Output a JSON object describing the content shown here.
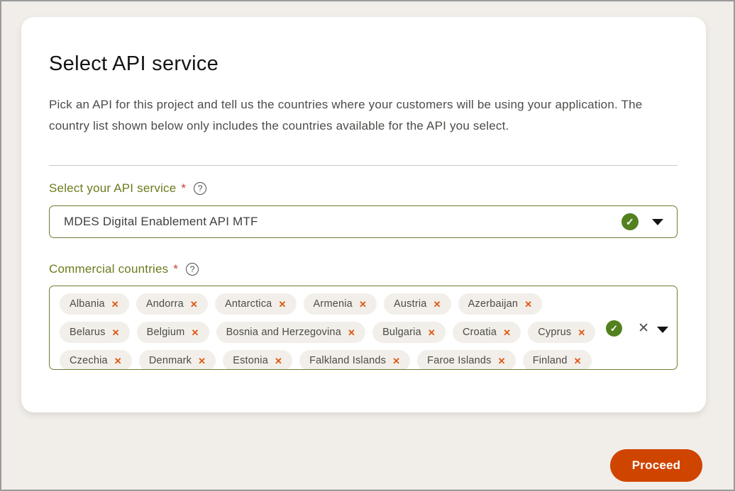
{
  "page": {
    "title": "Select API service",
    "description": "Pick an API for this project and tell us the countries where your customers will be using your application. The country list shown below only includes the countries available for the API you select."
  },
  "icons": {
    "help_glyph": "?",
    "check_glyph": "✓",
    "chip_remove_glyph": "✕",
    "clear_glyph": "✕"
  },
  "api_service_field": {
    "label": "Select your API service",
    "required_marker": "*",
    "selected_value": "MDES Digital Enablement API MTF"
  },
  "countries_field": {
    "label": "Commercial countries",
    "required_marker": "*",
    "selected_countries": [
      "Albania",
      "Andorra",
      "Antarctica",
      "Armenia",
      "Austria",
      "Azerbaijan",
      "Belarus",
      "Belgium",
      "Bosnia and Herzegovina",
      "Bulgaria",
      "Croatia",
      "Cyprus",
      "Czechia",
      "Denmark",
      "Estonia",
      "Falkland Islands",
      "Faroe Islands",
      "Finland"
    ]
  },
  "footer": {
    "proceed_label": "Proceed"
  },
  "colors": {
    "background": "#f1eee9",
    "card": "#ffffff",
    "label_green": "#697c1d",
    "field_border_green": "#6f7a33",
    "check_green": "#538120",
    "chip_background": "#f2efea",
    "chip_remove_orange": "#df5713",
    "required_red": "#d23b30",
    "proceed_orange": "#cf4500"
  }
}
